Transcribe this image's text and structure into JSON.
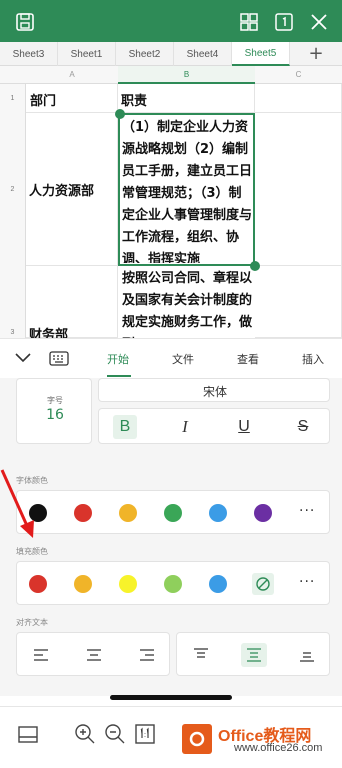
{
  "colors": {
    "accent": "#2e8b57",
    "font_colors": [
      "#111111",
      "#d9342b",
      "#f0b429",
      "#3aa657",
      "#3b9ce6",
      "#6b2fa3"
    ],
    "fill_colors": [
      "#d9342b",
      "#f0b429",
      "#f7f32a",
      "#8fcf5c",
      "#3b9ce6"
    ]
  },
  "sheets": [
    "Sheet3",
    "Sheet1",
    "Sheet2",
    "Sheet4",
    "Sheet5"
  ],
  "active_sheet": "Sheet5",
  "columns": [
    "A",
    "B",
    "C"
  ],
  "rows": [
    {
      "num": "1",
      "a": "部门",
      "b": "职责"
    },
    {
      "num": "2",
      "a": "人力资源部",
      "b": "（1）制定企业人力资源战略规划（2）编制员工手册，建立员工日常管理规范；（3）制定企业人事管理制度与工作流程，组织、协调、指挥实施"
    },
    {
      "num": "3",
      "a": "财务部",
      "b": "按照公司合同、章程以及国家有关会计制度的规定实施财务工作，做到"
    }
  ],
  "panel_tabs": [
    "开始",
    "文件",
    "查看",
    "插入"
  ],
  "font": {
    "size_label": "字号",
    "size_value": "16",
    "name": "宋体"
  },
  "format_buttons": [
    "B",
    "I",
    "U",
    "S"
  ],
  "labels": {
    "font_color": "字体颜色",
    "fill_color": "填充颜色",
    "align_text": "对齐文本"
  },
  "more_label": "···",
  "watermark": {
    "brand": "Office教程网",
    "url": "www.office26.com"
  }
}
